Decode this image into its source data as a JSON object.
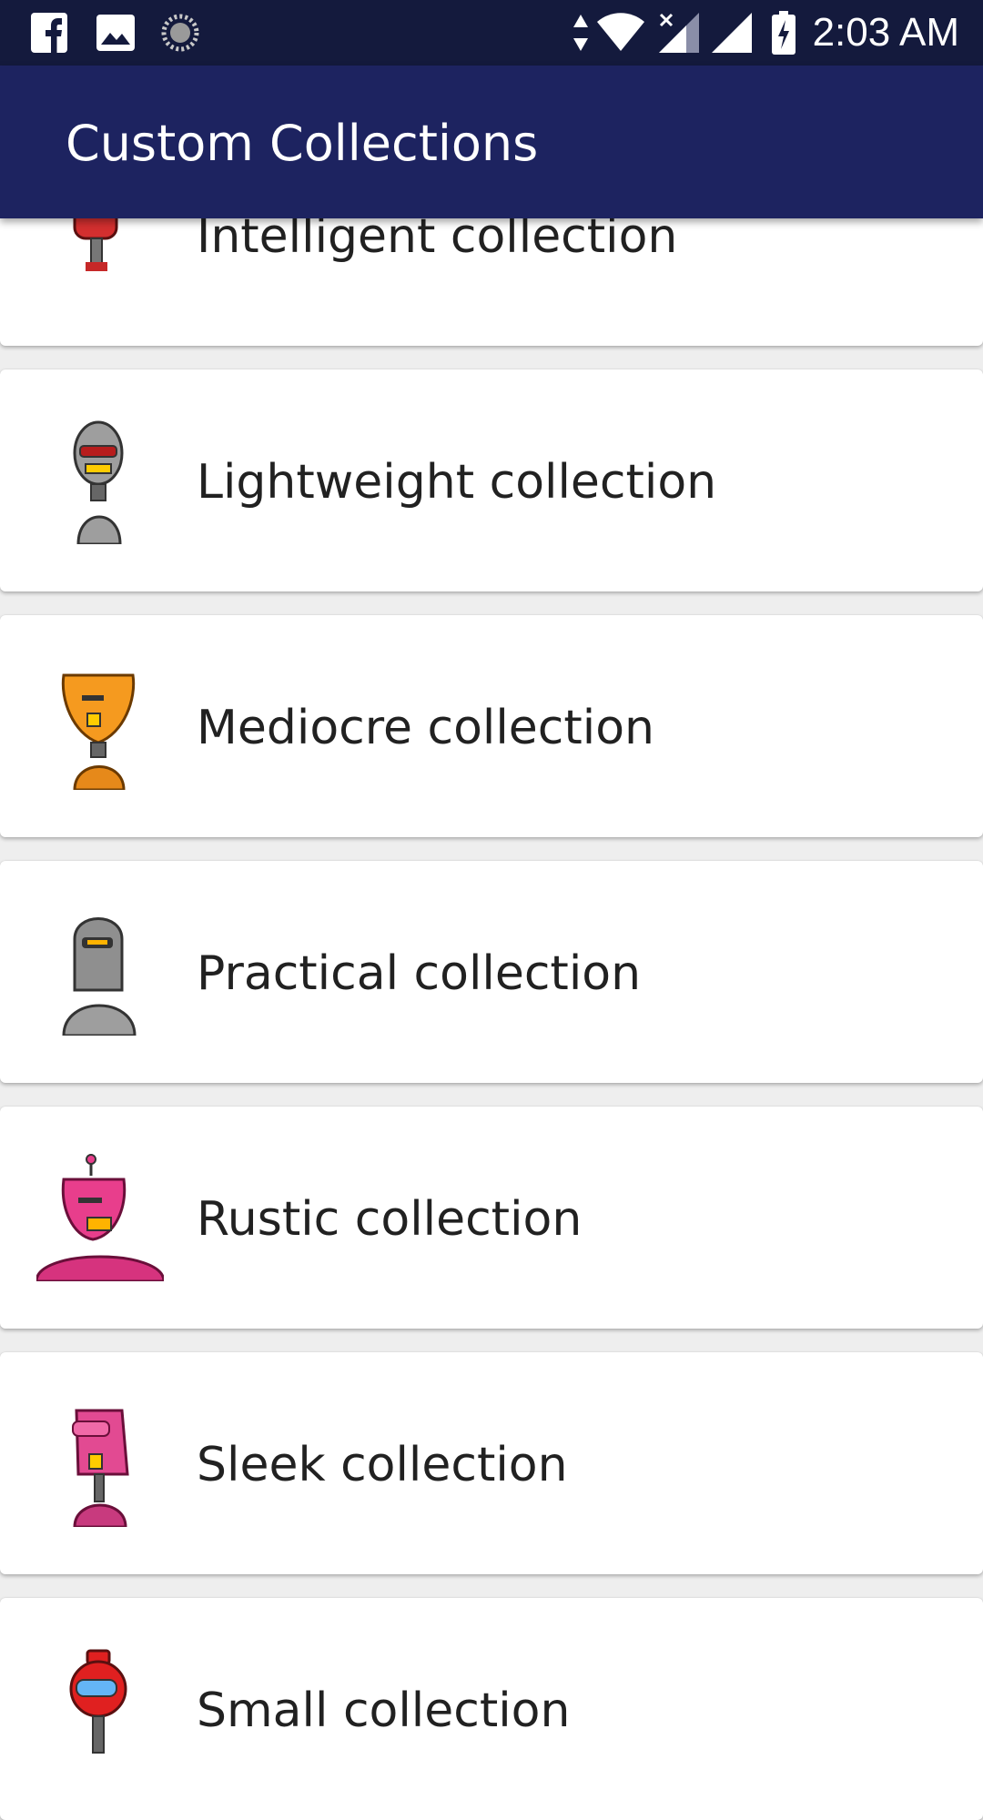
{
  "status_bar": {
    "time": "2:03 AM",
    "icons": [
      "facebook-icon",
      "gallery-icon",
      "sync-icon",
      "data-arrows-icon",
      "wifi-icon",
      "signal-no-sim-icon",
      "signal-icon",
      "battery-charging-icon"
    ]
  },
  "app_bar": {
    "title": "Custom Collections",
    "color": "#1d2360"
  },
  "collections": [
    {
      "label": "Intelligent collection",
      "icon": "red-robot-icon",
      "color": "#d32f2f"
    },
    {
      "label": "Lightweight collection",
      "icon": "gray-robot-icon",
      "color": "#9e9e9e"
    },
    {
      "label": "Mediocre collection",
      "icon": "orange-robot-icon",
      "color": "#f59a1f"
    },
    {
      "label": "Practical collection",
      "icon": "gray-helmet-robot-icon",
      "color": "#8f8f8f"
    },
    {
      "label": "Rustic collection",
      "icon": "pink-robot-icon",
      "color": "#e83e8c"
    },
    {
      "label": "Sleek collection",
      "icon": "pink-box-robot-icon",
      "color": "#e24a92"
    },
    {
      "label": "Small collection",
      "icon": "red-round-robot-icon",
      "color": "#e02020"
    }
  ]
}
